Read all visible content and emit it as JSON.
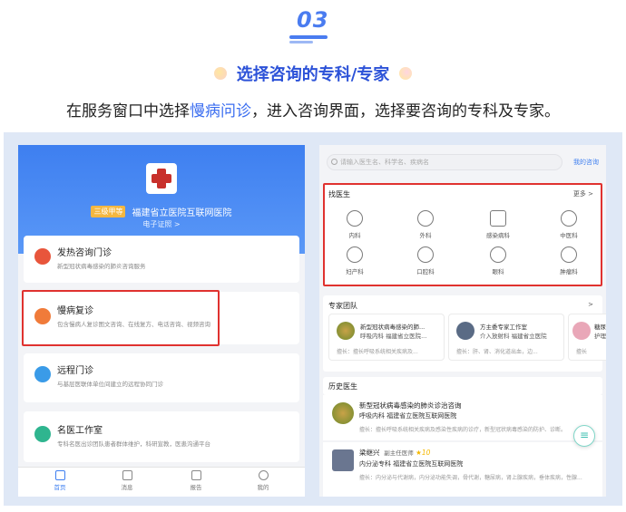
{
  "step": {
    "number": "03"
  },
  "heading": "选择咨询的专科/专家",
  "subtitle": {
    "before": "在服务窗口中选择",
    "highlight": "慢病问诊",
    "after": "，进入咨询界面，选择要咨询的专科及专家。"
  },
  "left_phone": {
    "hospital_tag": "三级甲等",
    "hospital_name": "福建省立医院互联网医院",
    "e_card": "电子证照 >",
    "services": [
      {
        "title": "发热咨询门诊",
        "desc": "新型冠状病毒感染的肺炎咨询服务"
      },
      {
        "title": "慢病复诊",
        "desc": "包含慢病人复诊图文咨询、在线复方、电话咨询、视频咨询"
      },
      {
        "title": "远程门诊",
        "desc": "与基层医联体单位间建立的远程协同门诊"
      },
      {
        "title": "名医工作室",
        "desc": "专科名医出诊团队患者群体维护，科研宣教，医患沟通平台"
      }
    ],
    "tabs": [
      "首页",
      "消息",
      "报告",
      "我的"
    ]
  },
  "right_phone": {
    "search_placeholder": "请输入医生名、科学名、疾病名",
    "my_consult": "我的咨询",
    "find_doctor": "找医生",
    "more": "更多 >",
    "departments": [
      "内科",
      "外科",
      "感染病科",
      "中医科",
      "妇产科",
      "口腔科",
      "眼科",
      "肿瘤科"
    ],
    "expert_team": "专家团队",
    "teams": [
      {
        "name": "新型冠状病毒感染的肺...",
        "hospital": "呼吸内科  福建省立医院...",
        "good_at": "擅长：擅长呼吸系统相关疾病及..."
      },
      {
        "name": "方主委专家工作室",
        "hospital": "介入放射科  福建省立医院",
        "good_at": "擅长：肝、肾、消化道出血，边..."
      },
      {
        "name": "糖尿病",
        "hospital": "护理",
        "good_at": "擅长"
      }
    ],
    "history": "历史医生",
    "history_doctors": [
      {
        "name": "新型冠状病毒感染的肺炎诊治咨询",
        "hospital": "呼吸内科  福建省立医院互联网医院",
        "good_at": "擅长：擅长呼吸系统相关疾病及感染性疾病的诊疗，新型冠状病毒感染的防护、诊断。"
      },
      {
        "name": "梁继兴",
        "title": "副主任医师",
        "score": "10",
        "hospital": "内分泌专科  福建省立医院互联网医院",
        "good_at": "擅长：内分泌与代谢病，内分泌功能失调，骨代谢，糖尿病，肾上腺疾病，垂体疾病，性腺..."
      }
    ]
  },
  "colors": {
    "accent": "#3e7ff0",
    "highlight_box": "#e0322f",
    "heading": "#2c52d8"
  }
}
